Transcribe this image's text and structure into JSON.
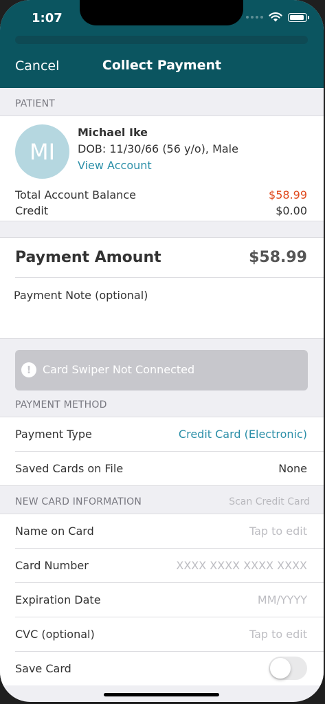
{
  "status": {
    "time": "1:07"
  },
  "nav": {
    "cancel": "Cancel",
    "title": "Collect Payment"
  },
  "patient": {
    "section": "PATIENT",
    "initials": "MI",
    "name": "Michael Ike",
    "dob": "DOB: 11/30/66 (56 y/o), Male",
    "link": "View Account",
    "balance_label": "Total Account Balance",
    "balance_value": "$58.99",
    "credit_label": "Credit",
    "credit_value": "$0.00"
  },
  "payment": {
    "label": "Payment Amount",
    "amount": "$58.99",
    "note_placeholder": "Payment Note (optional)"
  },
  "swiper": {
    "icon": "!",
    "text": "Card Swiper Not Connected"
  },
  "method": {
    "section": "PAYMENT METHOD",
    "type_label": "Payment Type",
    "type_value": "Credit Card (Electronic)",
    "saved_label": "Saved Cards on File",
    "saved_value": "None"
  },
  "newcard": {
    "section": "NEW CARD INFORMATION",
    "scan": "Scan Credit Card",
    "fields": [
      {
        "label": "Name on Card",
        "placeholder": "Tap to edit"
      },
      {
        "label": "Card Number",
        "placeholder": "XXXX XXXX XXXX XXXX"
      },
      {
        "label": "Expiration Date",
        "placeholder": "MM/YYYY"
      },
      {
        "label": "CVC (optional)",
        "placeholder": "Tap to edit"
      }
    ],
    "save_label": "Save Card",
    "save_on": false
  },
  "icons": {
    "wifi": "wifi-icon",
    "battery": "battery-icon",
    "alert": "alert-icon"
  },
  "colors": {
    "header": "#0b5560",
    "accent": "#2b8fa8",
    "balance": "#e04a1e"
  }
}
